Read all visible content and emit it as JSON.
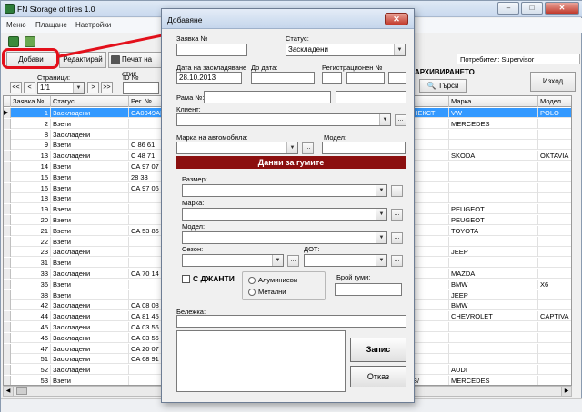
{
  "main": {
    "title": "FN Storage of tires 1.0",
    "menu": [
      "Меню",
      "Плащане",
      "Настройки"
    ],
    "toolbar": {
      "add": "Добави",
      "edit": "Редактирай",
      "print": "Печат на етик"
    },
    "pager": {
      "pages_label": "Страници:",
      "page_value": "1/1",
      "id_label": "ID №"
    },
    "user_label": "Потребител: Supervisor",
    "archive_label": "АРХИВИРАНЕТО",
    "search_btn": "Търси",
    "exit_btn": "Изход",
    "columns": [
      "Заявка №",
      "Статус",
      "Рег. №",
      "",
      "",
      "Марка",
      "Модел"
    ],
    "rows": [
      {
        "n": "1",
        "status": "Заскладени",
        "reg": "CA0949AP",
        "mid": "НЕКСТ",
        "brand": "VW",
        "model": "POLO",
        "selected": true
      },
      {
        "n": "2",
        "status": "Взети",
        "reg": "",
        "mid": "",
        "brand": "MERCEDES",
        "model": ""
      },
      {
        "n": "8",
        "status": "Заскладени",
        "reg": "",
        "mid": "",
        "brand": "",
        "model": ""
      },
      {
        "n": "9",
        "status": "Взети",
        "reg": "C 86 61",
        "mid": "",
        "brand": "",
        "model": ""
      },
      {
        "n": "13",
        "status": "Заскладени",
        "reg": "C 48 71",
        "mid": "",
        "brand": "SKODA",
        "model": "OKTAVIA"
      },
      {
        "n": "14",
        "status": "Взети",
        "reg": "CA 97 07",
        "mid": "",
        "brand": "",
        "model": ""
      },
      {
        "n": "15",
        "status": "Взети",
        "reg": "28 33",
        "mid": "",
        "brand": "",
        "model": ""
      },
      {
        "n": "16",
        "status": "Взети",
        "reg": "CA 97 06",
        "mid": "",
        "brand": "",
        "model": ""
      },
      {
        "n": "18",
        "status": "Взети",
        "reg": "",
        "mid": "",
        "brand": "",
        "model": ""
      },
      {
        "n": "19",
        "status": "Взети",
        "reg": "",
        "mid": "",
        "brand": "PEUGEOT",
        "model": ""
      },
      {
        "n": "20",
        "status": "Взети",
        "reg": "",
        "mid": "",
        "brand": "PEUGEOT",
        "model": ""
      },
      {
        "n": "21",
        "status": "Взети",
        "reg": "CA 53 86",
        "mid": "",
        "brand": "TOYOTA",
        "model": ""
      },
      {
        "n": "22",
        "status": "Взети",
        "reg": "",
        "mid": "",
        "brand": "",
        "model": ""
      },
      {
        "n": "23",
        "status": "Заскладени",
        "reg": "",
        "mid": "",
        "brand": "JEEP",
        "model": ""
      },
      {
        "n": "31",
        "status": "Взети",
        "reg": "",
        "mid": "",
        "brand": "",
        "model": ""
      },
      {
        "n": "33",
        "status": "Заскладени",
        "reg": "CA 70 14 H",
        "mid": "",
        "brand": "MAZDA",
        "model": ""
      },
      {
        "n": "36",
        "status": "Взети",
        "reg": "",
        "mid": "",
        "brand": "BMW",
        "model": "X6"
      },
      {
        "n": "38",
        "status": "Взети",
        "reg": "",
        "mid": "",
        "brand": "JEEP",
        "model": ""
      },
      {
        "n": "42",
        "status": "Заскладени",
        "reg": "CA 08 08 KN",
        "mid": "",
        "brand": "BMW",
        "model": ""
      },
      {
        "n": "44",
        "status": "Заскладени",
        "reg": "CA 81 45",
        "mid": "",
        "brand": "CHEVROLET",
        "model": "CAPTIVA"
      },
      {
        "n": "45",
        "status": "Заскладени",
        "reg": "CA 03 56",
        "mid": "",
        "brand": "",
        "model": ""
      },
      {
        "n": "46",
        "status": "Заскладени",
        "reg": "CA 03 56",
        "mid": "",
        "brand": "",
        "model": ""
      },
      {
        "n": "47",
        "status": "Заскладени",
        "reg": "CA 20 07",
        "mid": "",
        "brand": "",
        "model": ""
      },
      {
        "n": "51",
        "status": "Заскладени",
        "reg": "CA 68 91 BK",
        "mid": "",
        "brand": "",
        "model": ""
      },
      {
        "n": "52",
        "status": "Заскладени",
        "reg": "",
        "mid": "",
        "brand": "AUDI",
        "model": ""
      },
      {
        "n": "53",
        "status": "Взети",
        "reg": "",
        "mid": "B/",
        "brand": "MERCEDES",
        "model": ""
      }
    ]
  },
  "dialog": {
    "title": "Добавяне",
    "order_no_label": "Заявка №",
    "order_no_value": "",
    "status_label": "Статус:",
    "status_value": "Заскладени",
    "store_date_label": "Дата на заскладяване",
    "store_date_value": "28.10.2013",
    "to_date_label": "До дата:",
    "to_date_value": "",
    "reg_no_label": "Регистрационен №",
    "frame_label": "Рама №:",
    "client_label": "Клиент:",
    "car_brand_label": "Марка на автомобила:",
    "model_label": "Модел:",
    "tire_header": "Данни за гумите",
    "size_label": "Размер:",
    "brand_label": "Марка:",
    "tire_model_label": "Модел:",
    "season_label": "Сезон:",
    "dot_label": "ДОТ:",
    "with_rims_label": "С ДЖАНТИ",
    "aluminium_label": "Алуминиеви",
    "metal_label": "Метални",
    "tire_count_label": "Брой гуми:",
    "note_label": "Бележка:",
    "save_btn": "Запис",
    "cancel_btn": "Отказ",
    "dots_label": "..."
  },
  "colors": {
    "selection": "#3399ff",
    "tire_header_bg": "#8b0f0f",
    "highlight": "#e3101b"
  }
}
